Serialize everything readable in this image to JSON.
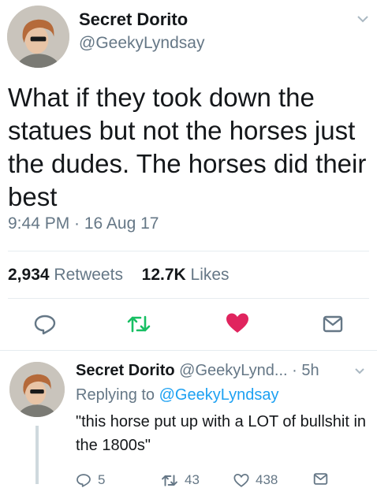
{
  "tweet": {
    "author_name": "Secret Dorito",
    "author_handle": "@GeekyLyndsay",
    "text": "What if they took down the statues but not the horses just the dudes. The horses did their best",
    "timestamp": "9:44 PM · 16 Aug 17",
    "retweets_count": "2,934",
    "retweets_label": "Retweets",
    "likes_count": "12.7K",
    "likes_label": "Likes",
    "liked": true,
    "colors": {
      "retweet_green": "#17bf63",
      "like_red": "#e0245e",
      "icon_gray": "#657786",
      "link_blue": "#1da1f2"
    },
    "icons": [
      "reply-icon",
      "retweet-icon",
      "heart-icon",
      "direct-message-icon",
      "chevron-down-icon"
    ]
  },
  "reply": {
    "author_name": "Secret Dorito",
    "meta": "@GeekyLynd... · 5h",
    "replying_prefix": "Replying to",
    "replying_to": "@GeekyLyndsay",
    "text": "\"this horse put up with a LOT of bullshit in the 1800s\"",
    "reply_count": "5",
    "retweet_count": "43",
    "like_count": "438"
  }
}
